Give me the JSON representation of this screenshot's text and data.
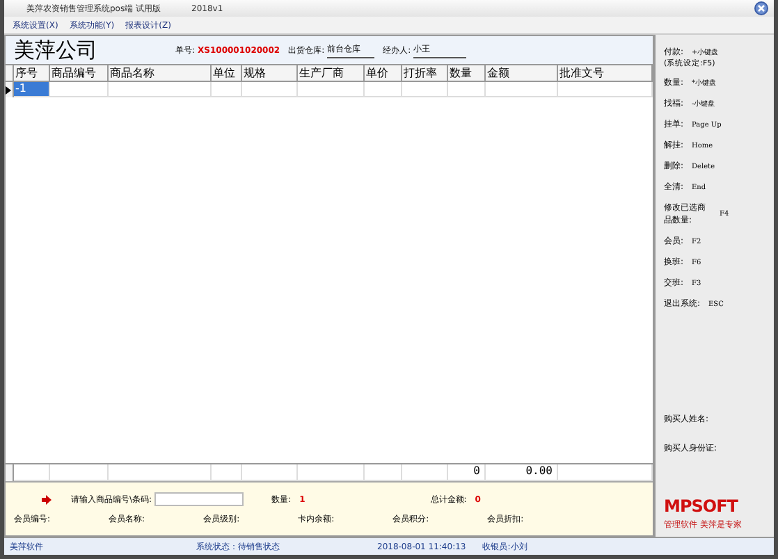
{
  "window": {
    "title": "美萍农资销售管理系统pos端 试用版",
    "version": "2018v1"
  },
  "menu": [
    {
      "label": "系统设置(X)"
    },
    {
      "label": "系统功能(Y)"
    },
    {
      "label": "报表设计(Z)"
    }
  ],
  "header": {
    "company": "美萍公司",
    "order_label": "单号:",
    "order_no": "XS100001020002",
    "warehouse_label": "出货仓库:",
    "warehouse": "前台仓库",
    "handler_label": "经办人:",
    "handler": "小王"
  },
  "table": {
    "columns": [
      "序号",
      "商品编号",
      "商品名称",
      "单位",
      "规格",
      "生产厂商",
      "单价",
      "打折率",
      "数量",
      "金额",
      "批准文号"
    ],
    "rows": [
      {
        "number": "-1",
        "selected": true
      }
    ],
    "totals": {
      "quantity": "0",
      "amount": "0.00"
    }
  },
  "input": {
    "prompt": "请输入商品编号\\条码:",
    "quantity_label": "数量:",
    "quantity": "1",
    "total_label": "总计金额:",
    "total": "0"
  },
  "member": [
    "会员编号:",
    "会员名称:",
    "会员级别:",
    "卡内余额:",
    "会员积分:",
    "会员折扣:"
  ],
  "shortcuts": [
    {
      "label": "付款:",
      "key": "+小键盘",
      "note": "(系统设定:F5)"
    },
    {
      "label": "数量:",
      "key": "*小键盘"
    },
    {
      "label": "找福:",
      "key": "-小键盘"
    },
    {
      "label": "挂单:",
      "key": "Page Up"
    },
    {
      "label": "解挂:",
      "key": "Home"
    },
    {
      "label": "删除:",
      "key": "Delete"
    },
    {
      "label": "全清:",
      "key": "End"
    },
    {
      "label": "修改已选商品数量:",
      "key": "F4"
    },
    {
      "label": "会员:",
      "key": "F2"
    },
    {
      "label": "换班:",
      "key": "F6"
    },
    {
      "label": "交班:",
      "key": "F3"
    },
    {
      "label": "退出系统:",
      "key": "ESC"
    }
  ],
  "buyer": [
    "购买人姓名:",
    "购买人身份证:"
  ],
  "brand": {
    "logo": "MPSOFT",
    "slogan": "管理软件 美萍是专家"
  },
  "status_bar": [
    "美萍软件",
    "系统状态：待销售状态",
    "2018-08-01 11:40:13",
    "收银员:小刘"
  ]
}
